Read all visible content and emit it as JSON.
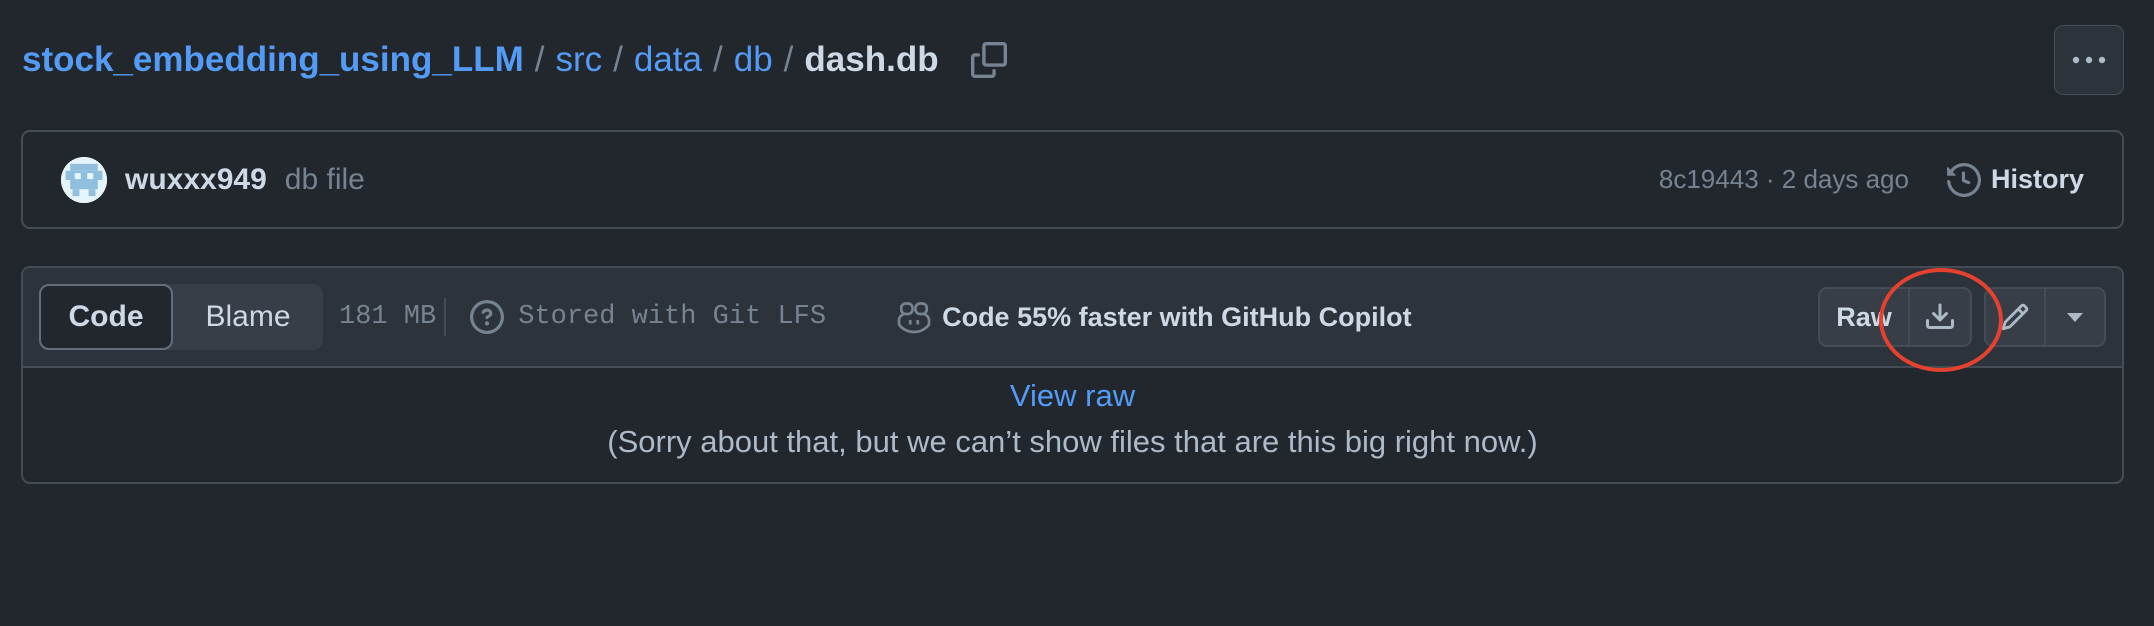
{
  "breadcrumb": {
    "repo": "stock_embedding_using_LLM",
    "sep": "/",
    "path": [
      "src",
      "data",
      "db"
    ],
    "file": "dash.db"
  },
  "commit": {
    "author": "wuxxx949",
    "message": "db file",
    "sha_time": "8c19443 · 2 days ago",
    "history_label": "History"
  },
  "file_header": {
    "code_tab": "Code",
    "blame_tab": "Blame",
    "size": "181 MB",
    "lfs_label": "Stored with Git LFS",
    "copilot_label": "Code 55% faster with GitHub Copilot",
    "raw_label": "Raw"
  },
  "file_body": {
    "view_raw": "View raw",
    "message": "(Sorry about that, but we can’t show files that are this big right now.)"
  },
  "icons": [
    "copy-icon",
    "kebab-icon",
    "history-icon",
    "question-icon",
    "copilot-icon",
    "download-icon",
    "pencil-icon",
    "triangle-down-icon"
  ],
  "colors": {
    "background": "#22272e",
    "link": "#539bf5",
    "annotation": "#e5412f"
  }
}
